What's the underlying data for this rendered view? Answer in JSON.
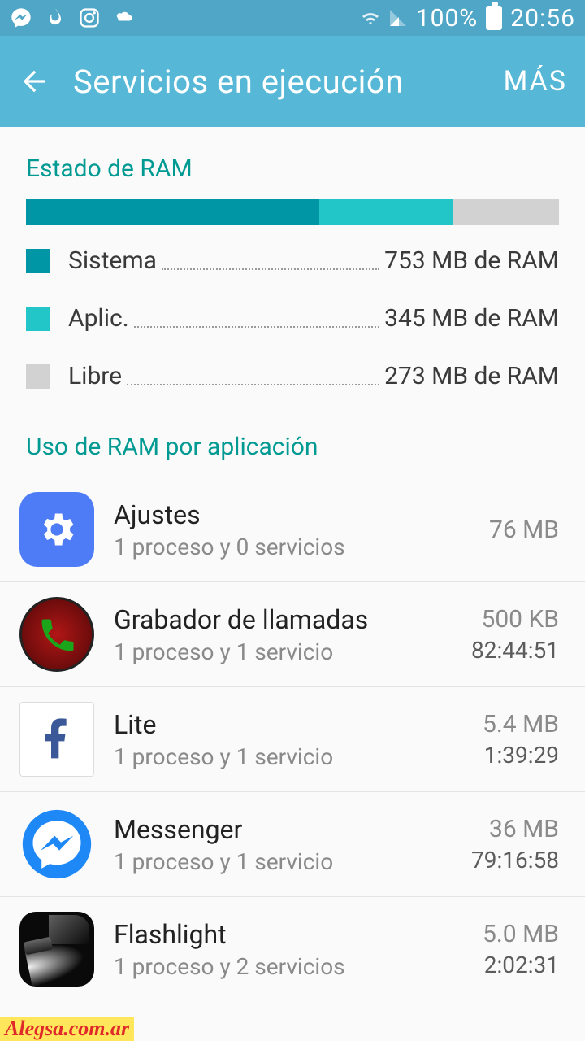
{
  "status": {
    "percent": "100%",
    "time": "20:56"
  },
  "appbar": {
    "title": "Servicios en ejecución",
    "more": "MÁS"
  },
  "ram_section_title": "Estado de RAM",
  "ram_bar": {
    "sys_pct": 55,
    "app_pct": 25
  },
  "legend": [
    {
      "color": "#0096a6",
      "label": "Sistema",
      "value": "753 MB de RAM"
    },
    {
      "color": "#22c6c9",
      "label": "Aplic.",
      "value": "345 MB de RAM"
    },
    {
      "color": "#d2d2d2",
      "label": "Libre",
      "value": "273 MB de RAM"
    }
  ],
  "usage_section_title": "Uso de RAM por aplicación",
  "apps": [
    {
      "name": "Ajustes",
      "sub": "1 proceso y 0 servicios",
      "size": "76 MB",
      "time": ""
    },
    {
      "name": "Grabador de llamadas",
      "sub": "1 proceso y 1 servicio",
      "size": "500 KB",
      "time": "82:44:51"
    },
    {
      "name": "Lite",
      "sub": "1 proceso y 1 servicio",
      "size": "5.4 MB",
      "time": "1:39:29"
    },
    {
      "name": "Messenger",
      "sub": "1 proceso y 1 servicio",
      "size": "36 MB",
      "time": "79:16:58"
    },
    {
      "name": "Flashlight",
      "sub": "1 proceso y 2 servicios",
      "size": "5.0 MB",
      "time": "2:02:31"
    }
  ],
  "watermark": "Alegsa.com.ar"
}
